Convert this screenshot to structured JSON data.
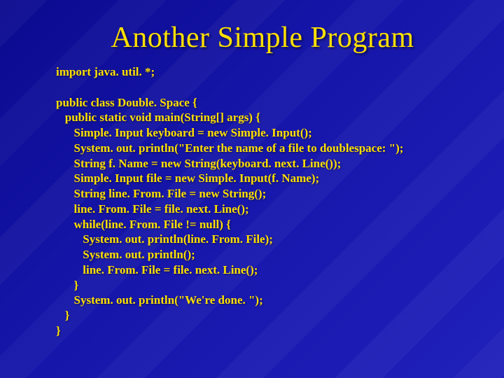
{
  "title": "Another Simple Program",
  "code": {
    "l00": "import java. util. *;",
    "l01": "",
    "l02": "public class Double. Space {",
    "l03": "   public static void main(String[] args) {",
    "l04": "      Simple. Input keyboard = new Simple. Input();",
    "l05": "      System. out. println(\"Enter the name of a file to doublespace: \");",
    "l06": "      String f. Name = new String(keyboard. next. Line());",
    "l07": "      Simple. Input file = new Simple. Input(f. Name);",
    "l08": "      String line. From. File = new String();",
    "l09": "      line. From. File = file. next. Line();",
    "l10": "      while(line. From. File != null) {",
    "l11": "         System. out. println(line. From. File);",
    "l12": "         System. out. println();",
    "l13": "         line. From. File = file. next. Line();",
    "l14": "      }",
    "l15": "      System. out. println(\"We're done. \");",
    "l16": "   }",
    "l17": "}"
  }
}
